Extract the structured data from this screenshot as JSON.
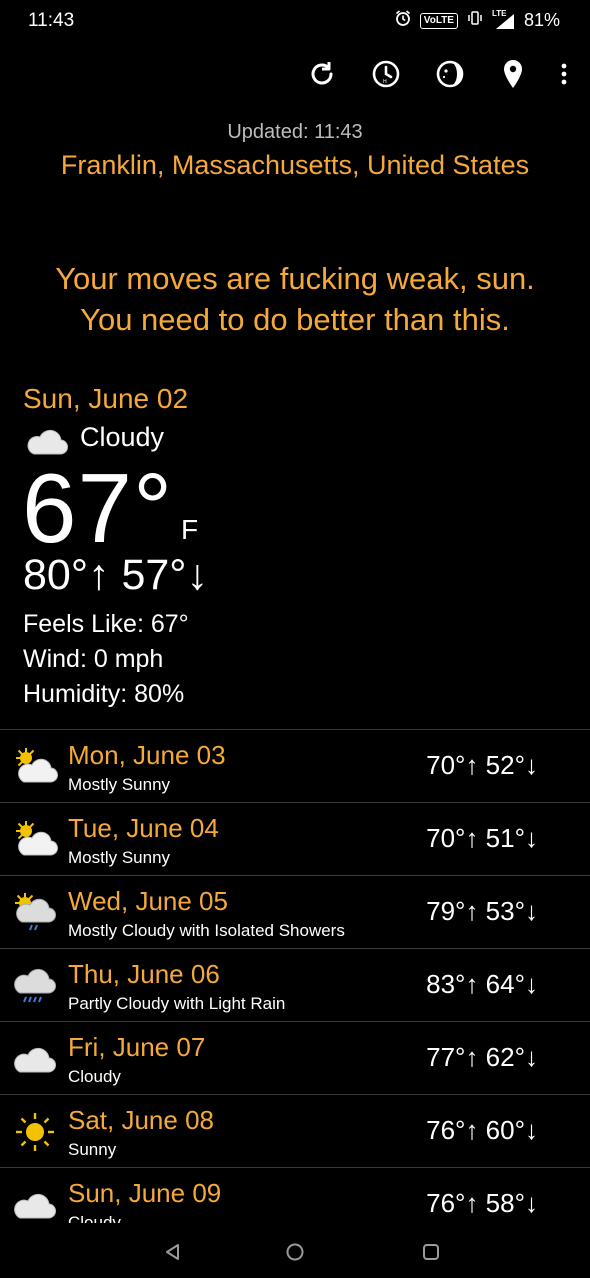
{
  "status_bar": {
    "time": "11:43",
    "volte": "VoLTE",
    "lte": "LTE",
    "battery": "81%"
  },
  "toolbar": {
    "icons": [
      "refresh-icon",
      "history-icon",
      "moon-phase-icon",
      "location-icon",
      "more-icon"
    ]
  },
  "header": {
    "updated": "Updated: 11:43",
    "location": "Franklin, Massachusetts, United States"
  },
  "quote": {
    "line1": "Your moves are fucking weak, sun.",
    "line2": "You need to do better than this."
  },
  "today": {
    "date": "Sun, June 02",
    "condition": "Cloudy",
    "temp": "67°",
    "unit": "F",
    "hilo": "80°↑ 57°↓",
    "feels_like": "Feels Like: 67°",
    "wind": "Wind: 0 mph",
    "humidity": "Humidity: 80%"
  },
  "forecast": [
    {
      "date": "Mon, June 03",
      "condition": "Mostly Sunny",
      "temps": "70°↑ 52°↓",
      "icon": "mostly-sunny-icon"
    },
    {
      "date": "Tue, June 04",
      "condition": "Mostly Sunny",
      "temps": "70°↑ 51°↓",
      "icon": "mostly-sunny-icon"
    },
    {
      "date": "Wed, June 05",
      "condition": "Mostly Cloudy with Isolated Showers",
      "temps": "79°↑ 53°↓",
      "icon": "showers-icon"
    },
    {
      "date": "Thu, June 06",
      "condition": "Partly Cloudy with Light Rain",
      "temps": "83°↑ 64°↓",
      "icon": "rain-icon"
    },
    {
      "date": "Fri, June 07",
      "condition": "Cloudy",
      "temps": "77°↑ 62°↓",
      "icon": "cloud-icon"
    },
    {
      "date": "Sat, June 08",
      "condition": "Sunny",
      "temps": "76°↑ 60°↓",
      "icon": "sun-icon"
    },
    {
      "date": "Sun, June 09",
      "condition": "Cloudy",
      "temps": "76°↑ 58°↓",
      "icon": "cloud-icon"
    }
  ],
  "colors": {
    "accent": "#f4a93a",
    "background": "#000000",
    "text": "#ffffff"
  }
}
